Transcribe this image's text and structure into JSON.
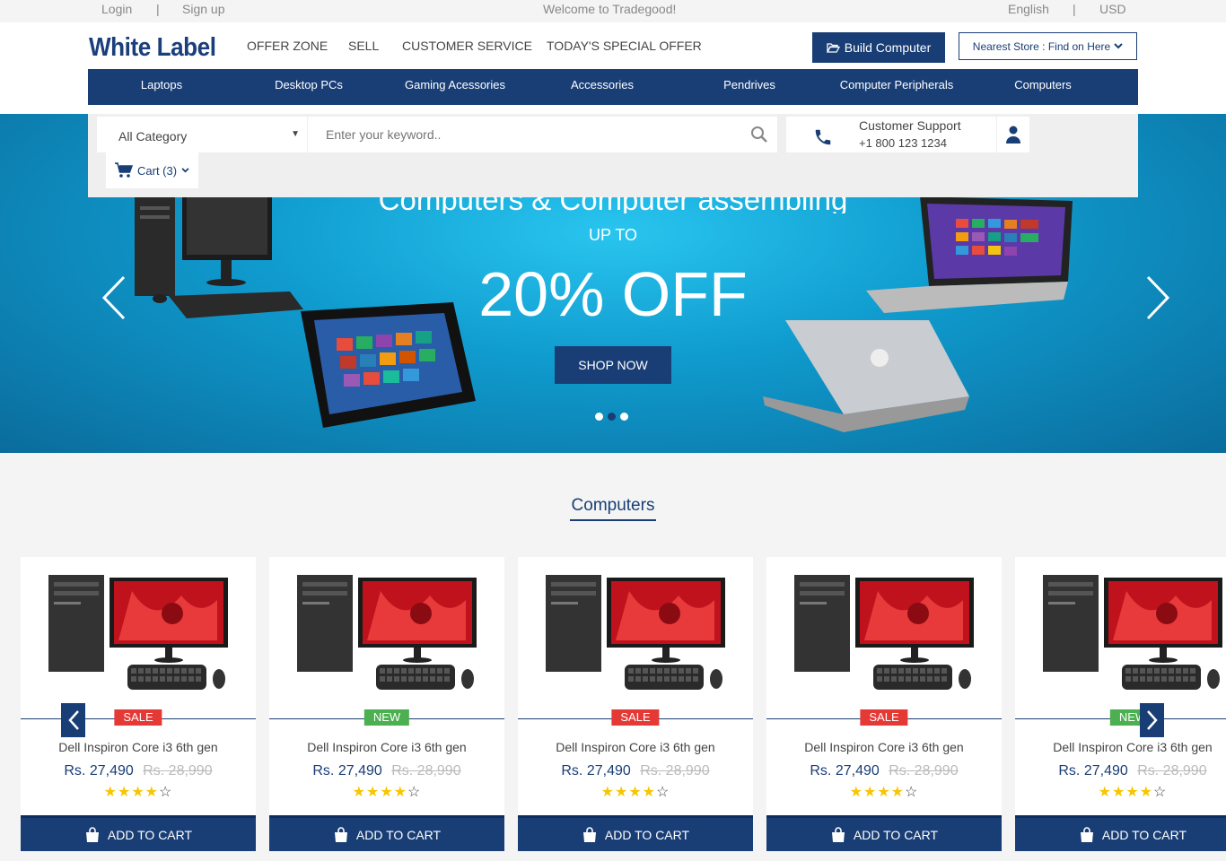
{
  "topbar": {
    "login": "Login",
    "sep1": "|",
    "signup": "Sign up",
    "welcome": "Welcome to Tradegood!",
    "language": "English",
    "sep2": "|",
    "currency": "USD"
  },
  "header": {
    "logo": "White Label",
    "nav": [
      "OFFER ZONE",
      "SELL",
      "CUSTOMER SERVICE",
      "TODAY'S SPECIAL OFFER"
    ],
    "build_label": "Build Computer",
    "store_label": "Nearest Store : Find on Here"
  },
  "categories": [
    "Laptops",
    "Desktop PCs",
    "Gaming Acessories",
    "Accessories",
    "Pendrives",
    "Computer Peripherals",
    "Computers"
  ],
  "search": {
    "category": "All Category",
    "placeholder": "Enter your keyword.."
  },
  "support": {
    "title": "Customer Support",
    "phone": "+1 800 123 1234"
  },
  "cart": {
    "label": "Cart (3)"
  },
  "hero": {
    "title": "Computers & Computer assembling",
    "upto": "UP TO",
    "offer": "20% OFF",
    "cta": "SHOP NOW",
    "slides": 3,
    "active_slide": 2
  },
  "section": {
    "title": "Computers"
  },
  "products": [
    {
      "badge": "SALE",
      "name": "Dell Inspiron Core i3 6th gen",
      "price": "Rs. 27,490",
      "old_price": "Rs. 28,990",
      "rating": 4,
      "cta": "ADD TO CART"
    },
    {
      "badge": "NEW",
      "name": "Dell Inspiron Core i3 6th gen",
      "price": "Rs. 27,490",
      "old_price": "Rs. 28,990",
      "rating": 4,
      "cta": "ADD TO CART"
    },
    {
      "badge": "SALE",
      "name": "Dell Inspiron Core i3 6th gen",
      "price": "Rs. 27,490",
      "old_price": "Rs. 28,990",
      "rating": 4,
      "cta": "ADD TO CART"
    },
    {
      "badge": "SALE",
      "name": "Dell Inspiron Core i3 6th gen",
      "price": "Rs. 27,490",
      "old_price": "Rs. 28,990",
      "rating": 4,
      "cta": "ADD TO CART"
    },
    {
      "badge": "NEW",
      "name": "Dell Inspiron Core i3 6th gen",
      "price": "Rs. 27,490",
      "old_price": "Rs. 28,990",
      "rating": 4,
      "cta": "ADD TO CART"
    }
  ],
  "colors": {
    "brand": "#193e76",
    "sale": "#e53935",
    "new": "#4caf50",
    "star": "#f7c600"
  }
}
